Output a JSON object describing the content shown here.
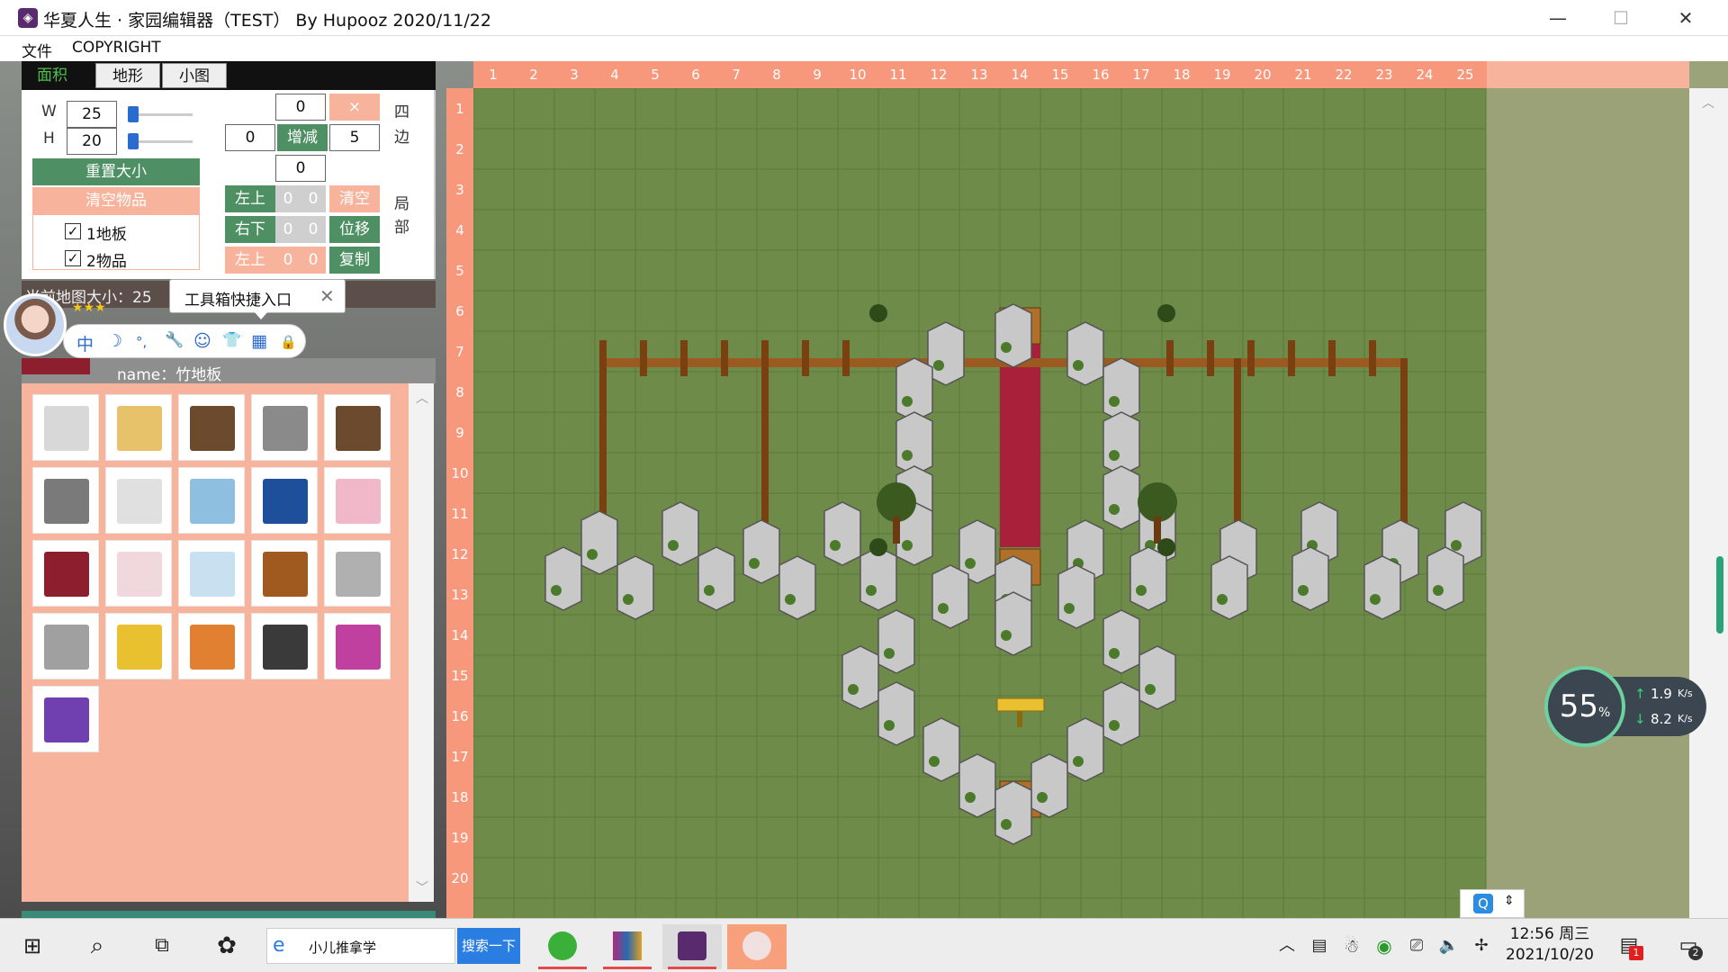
{
  "window": {
    "title": "华夏人生 · 家园编辑器（TEST）  By Hupooz  2020/11/22",
    "minimize": "—",
    "maximize": "☐",
    "close": "✕"
  },
  "menu": {
    "items": [
      "文件",
      "COPYRIGHT"
    ]
  },
  "tabs": [
    {
      "label": "面积",
      "active": true
    },
    {
      "label": "地形"
    },
    {
      "label": "小图"
    }
  ],
  "size_controls": {
    "w_label": "W",
    "w_value": "25",
    "h_label": "H",
    "h_value": "20",
    "reset_label": "重置大小",
    "clear_label": "清空物品",
    "checkbox1": "1地板",
    "checkbox2": "2物品",
    "check_mark": "✓"
  },
  "edge_controls": {
    "top": "0",
    "left": "0",
    "right": "5",
    "bottom": "0",
    "x_label": "×",
    "adjust_label": "增减",
    "side_label_1": "四",
    "side_label_2": "边"
  },
  "local_controls": {
    "row1": {
      "label": "左上",
      "v1": "0",
      "v2": "0",
      "action": "清空"
    },
    "row2": {
      "label": "右下",
      "v1": "0",
      "v2": "0",
      "action": "位移"
    },
    "row3": {
      "label": "左上",
      "v1": "0",
      "v2": "0",
      "action": "复制"
    },
    "side_label_1": "局",
    "side_label_2": "部"
  },
  "status": {
    "text": "当前地图大小：25",
    "stars": "★★★"
  },
  "tooltip": {
    "text": "工具箱快捷入口",
    "close": "✕"
  },
  "ime": {
    "icons": [
      "中",
      "☽",
      "°,",
      "🔧",
      "☺",
      "👕",
      "▦",
      "🔒"
    ]
  },
  "selected": {
    "name": "name：竹地板"
  },
  "tiles": [
    {
      "color": "#d8d8d8"
    },
    {
      "color": "#e8c26a"
    },
    {
      "color": "#6b4a2e"
    },
    {
      "color": "#8a8a8a"
    },
    {
      "color": "#6b4a2e"
    },
    {
      "color": "#7a7a7a"
    },
    {
      "color": "#e0e0e0"
    },
    {
      "color": "#8fbfe0"
    },
    {
      "color": "#1e4f9a"
    },
    {
      "color": "#f0b8c8"
    },
    {
      "color": "#8c1e2e"
    },
    {
      "color": "#f0d8dc"
    },
    {
      "color": "#c8e0f0"
    },
    {
      "color": "#a05a20"
    },
    {
      "color": "#b0b0b0"
    },
    {
      "color": "#a0a0a0"
    },
    {
      "color": "#e8c030"
    },
    {
      "color": "#e08030"
    },
    {
      "color": "#3a3a3a"
    },
    {
      "color": "#c040a0"
    },
    {
      "color": "#7040b0"
    }
  ],
  "map": {
    "cols": 25,
    "rows": 20,
    "col_labels": [
      "1",
      "2",
      "3",
      "4",
      "5",
      "6",
      "7",
      "8",
      "9",
      "10",
      "11",
      "12",
      "13",
      "14",
      "15",
      "16",
      "17",
      "18",
      "19",
      "20",
      "21",
      "22",
      "23",
      "24",
      "25"
    ],
    "row_labels": [
      "1",
      "2",
      "3",
      "4",
      "5",
      "6",
      "7",
      "8",
      "9",
      "10",
      "11",
      "12",
      "13",
      "14",
      "15",
      "16",
      "17",
      "18",
      "19",
      "20"
    ],
    "ground_color": "#6f8b4a",
    "grid_color": "#5a7a3a",
    "carpet_color": "#a8203a"
  },
  "net": {
    "percent": "55",
    "percent_unit": "%",
    "up": "1.9",
    "down": "8.2",
    "unit": "K/s"
  },
  "taskbar": {
    "search_text": "小儿推拿学",
    "search_button": "搜索一下",
    "time": "12:56 周三",
    "date": "2021/10/20",
    "notif_count": "1",
    "msg_count": "2"
  }
}
